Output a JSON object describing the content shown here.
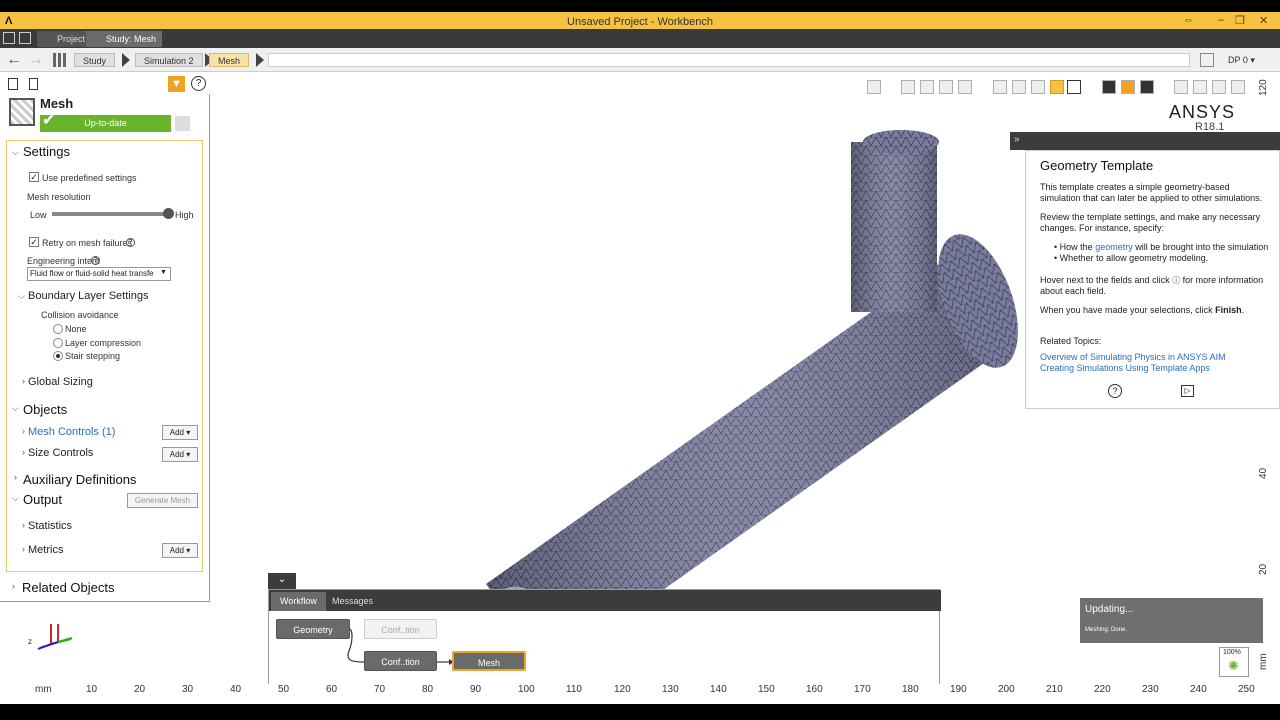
{
  "window": {
    "title": "Unsaved Project - Workbench",
    "logo": "Λ"
  },
  "tabs": [
    {
      "label": "Project"
    },
    {
      "label": "Study: Mesh"
    }
  ],
  "breadcrumb": [
    "Study",
    "Simulation 2",
    "Mesh"
  ],
  "dp": "DP 0",
  "panel": {
    "title": "Mesh",
    "status": "Up-to-date",
    "settings": {
      "header": "Settings",
      "predefined": "Use predefined settings",
      "resolution_label": "Mesh resolution",
      "low": "Low",
      "high": "High",
      "resolution_level": 1.0,
      "retry": "Retry on mesh failures",
      "intent_label": "Engineering intent",
      "intent_value": "Fluid flow or fluid-solid heat transfe",
      "boundary": "Boundary Layer Settings",
      "collision": "Collision avoidance",
      "options": [
        "None",
        "Layer compression",
        "Stair stepping"
      ],
      "global": "Global Sizing"
    },
    "objects": {
      "header": "Objects",
      "mesh_controls": "Mesh Controls (1)",
      "size_controls": "Size Controls",
      "add": "Add"
    },
    "aux": "Auxiliary Definitions",
    "output": {
      "header": "Output",
      "generate": "Generate Mesh",
      "statistics": "Statistics",
      "metrics": "Metrics"
    },
    "related": "Related Objects"
  },
  "brand": {
    "name": "ANSYS",
    "version": "R18.1"
  },
  "info": {
    "title": "Geometry Template",
    "p1": "This template creates a simple geometry-based simulation that can later be applied to other simulations.",
    "p2": "Review the template settings, and make any necessary changes. For instance, specify:",
    "b1_pre": "How the ",
    "b1_link": "geometry",
    "b1_post": " will be brought into the simulation",
    "b2": "Whether to allow geometry modeling.",
    "p3_pre": "Hover next to the fields and click",
    "p3_post": "for more information about each field.",
    "p4_pre": "When you have made your selections, click ",
    "p4_bold": "Finish",
    "related": "Related Topics:",
    "link1": "Overview of Simulating Physics in ANSYS AIM",
    "link2": "Creating Simulations Using Template Apps"
  },
  "workflow": {
    "tabs": [
      "Workflow",
      "Messages"
    ],
    "nodes": [
      "Geometry",
      "Conf..tion",
      "Conf..tion",
      "Mesh"
    ]
  },
  "toast": {
    "title": "Updating...",
    "detail": "Meshing: Done.",
    "progress": "100%"
  },
  "ruler": {
    "unit": "mm",
    "ticks": [
      "10",
      "20",
      "30",
      "40",
      "50",
      "60",
      "70",
      "80",
      "90",
      "100",
      "110",
      "120",
      "130",
      "140",
      "150",
      "160",
      "170",
      "180",
      "190",
      "200",
      "210",
      "220",
      "230",
      "240",
      "250"
    ],
    "vticks": [
      "120",
      "40",
      "20"
    ],
    "vunit": "mm"
  },
  "colors": {
    "accent": "#f5c242",
    "status": "#6ab42d",
    "mesh": "#7a7c9e",
    "link": "#2a6ebb"
  }
}
